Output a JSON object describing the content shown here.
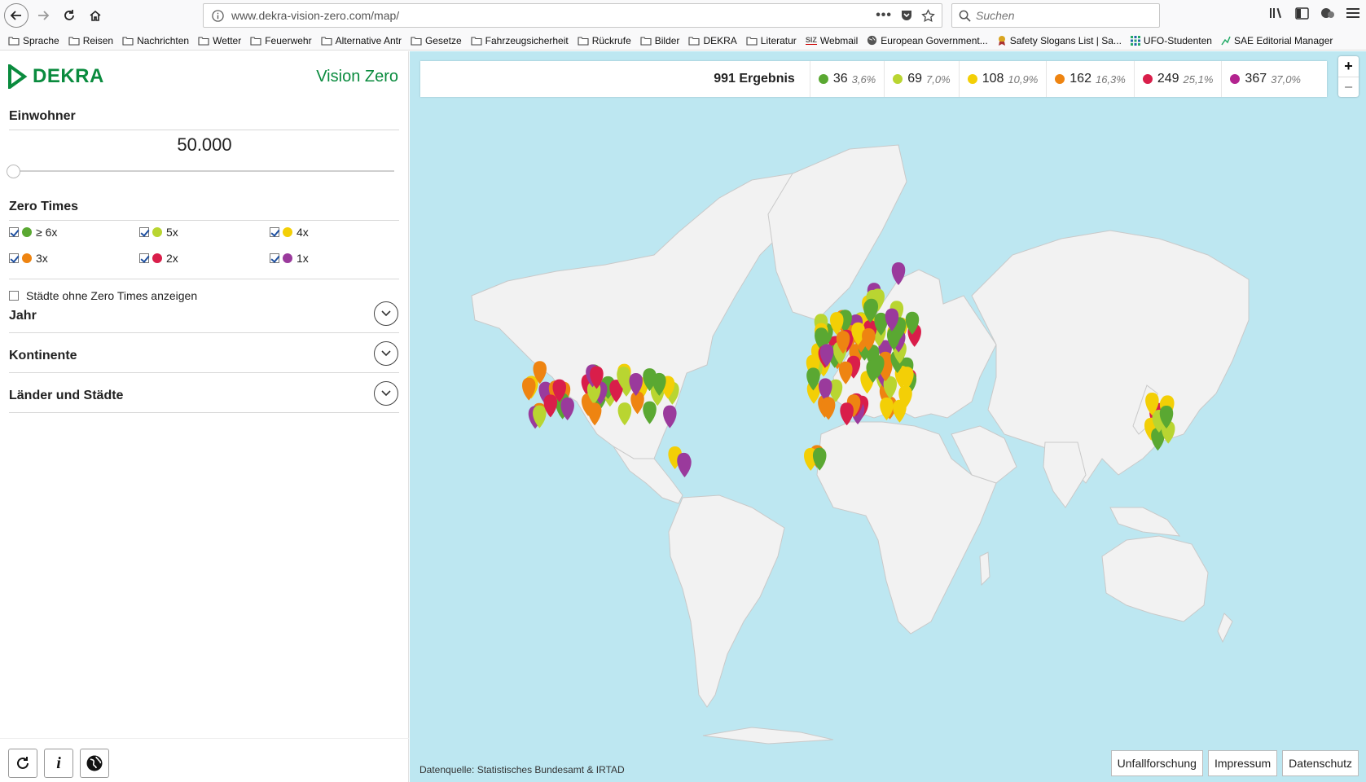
{
  "browser": {
    "url": "www.dekra-vision-zero.com/map/",
    "search_placeholder": "Suchen",
    "bookmarks": [
      {
        "label": "Sprache",
        "icon": "folder-icon"
      },
      {
        "label": "Reisen",
        "icon": "folder-icon"
      },
      {
        "label": "Nachrichten",
        "icon": "folder-icon"
      },
      {
        "label": "Wetter",
        "icon": "folder-icon"
      },
      {
        "label": "Feuerwehr",
        "icon": "folder-icon"
      },
      {
        "label": "Alternative Antr",
        "icon": "folder-icon"
      },
      {
        "label": "Gesetze",
        "icon": "folder-icon"
      },
      {
        "label": "Fahrzeugsicherheit",
        "icon": "folder-icon"
      },
      {
        "label": "Rückrufe",
        "icon": "folder-icon"
      },
      {
        "label": "Bilder",
        "icon": "folder-icon"
      },
      {
        "label": "DEKRA",
        "icon": "folder-icon"
      },
      {
        "label": "Literatur",
        "icon": "folder-icon"
      },
      {
        "label": "Webmail",
        "icon": "siz-icon"
      },
      {
        "label": "European Government...",
        "icon": "globe-icon"
      },
      {
        "label": "Safety Slogans List | Sa...",
        "icon": "award-icon"
      },
      {
        "label": "UFO-Studenten",
        "icon": "grid-icon"
      },
      {
        "label": "SAE Editorial Manager",
        "icon": "chart-icon"
      }
    ]
  },
  "sidebar": {
    "brand": "DEKRA",
    "tagline": "Vision Zero",
    "population": {
      "title": "Einwohner",
      "value": "50.000",
      "slider_fraction": 0.0
    },
    "zero_times": {
      "title": "Zero Times",
      "items": [
        {
          "label": "≥ 6x",
          "color": "#5aa832",
          "checked": true
        },
        {
          "label": "5x",
          "color": "#b9d531",
          "checked": true
        },
        {
          "label": "4x",
          "color": "#f3cf06",
          "checked": true
        },
        {
          "label": "3x",
          "color": "#ee8411",
          "checked": true
        },
        {
          "label": "2x",
          "color": "#d91e4a",
          "checked": true
        },
        {
          "label": "1x",
          "color": "#9a3a9c",
          "checked": true
        }
      ]
    },
    "show_without_label": "Städte ohne Zero Times anzeigen",
    "show_without_checked": false,
    "accordions": [
      {
        "label": "Jahr"
      },
      {
        "label": "Kontinente"
      },
      {
        "label": "Länder und Städte"
      }
    ]
  },
  "map": {
    "summary": {
      "total": "991 Ergebnis",
      "groups": [
        {
          "count": "36",
          "pct": "3,6%",
          "color": "#5aa832"
        },
        {
          "count": "69",
          "pct": "7,0%",
          "color": "#b9d531"
        },
        {
          "count": "108",
          "pct": "10,9%",
          "color": "#f3cf06"
        },
        {
          "count": "162",
          "pct": "16,3%",
          "color": "#ee8411"
        },
        {
          "count": "249",
          "pct": "25,1%",
          "color": "#d91e4a"
        },
        {
          "count": "367",
          "pct": "37,0%",
          "color": "#b3238f"
        }
      ]
    },
    "zoom_in": "+",
    "zoom_out": "−",
    "source": "Datenquelle: Statistisches Bundesamt & IRTAD",
    "buttons": [
      "Unfallforschung",
      "Impressum",
      "Datenschutz"
    ]
  }
}
